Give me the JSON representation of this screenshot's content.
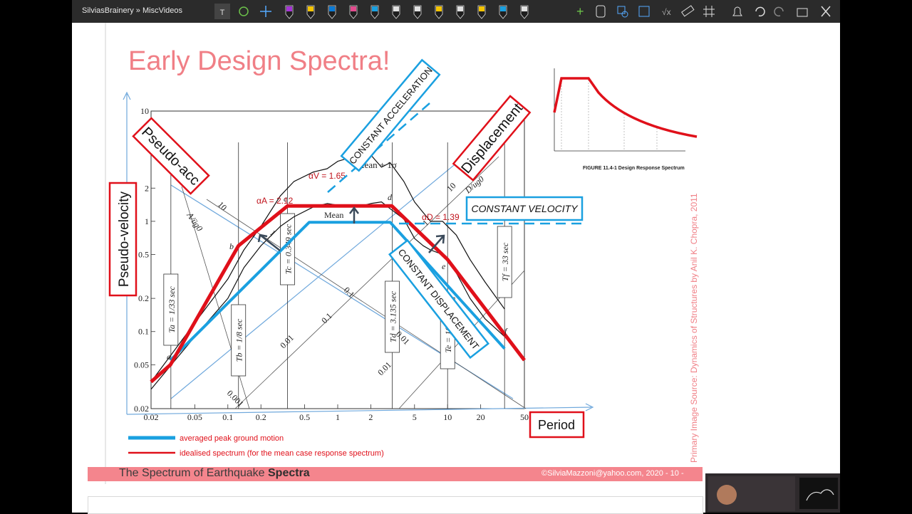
{
  "app": {
    "breadcrumb": "SilviasBrainery » MiscVideos"
  },
  "toolbar": {
    "pen_colors": [
      "#a633d6",
      "#f5c400",
      "#0a7ad6",
      "#e34c8f",
      "#1aa0e0",
      "#e2e2e2",
      "#e2e2e2",
      "#f5c400",
      "#e2e2e2",
      "#f5c400",
      "#1aa0e0",
      "#e2e2e2"
    ]
  },
  "slide": {
    "title": "Early Design Spectra!",
    "footer_left_prefix": "The Spectrum of Earthquake ",
    "footer_left_bold": "Spectra",
    "footer_right": "©SilviaMazzoni@yahoo.com, 2020 - 10 -",
    "source_note": "Primary Image Source: Dynamics of Structures by Anil K. Chopra, 2011",
    "legend": {
      "blue": "averaged peak ground motion",
      "red": "idealised spectrum (for the mean case response spectrum)"
    },
    "boxes": {
      "pseudo_acc": "Pseudo-acc",
      "pseudo_velocity": "Pseudo-velocity",
      "displacement": "Displacement",
      "constant_acceleration": "CONSTANT ACCELERATION",
      "constant_velocity": "CONSTANT VELOCITY",
      "constant_displacement": "CONSTANT DISPLACEMENT",
      "period": "Period"
    },
    "annotations": {
      "alpha_a": "αA = 2.12",
      "alpha_v": "αV = 1.65",
      "alpha_d": "αD = 1.39",
      "mean_plus": "Mean + 1σ",
      "mean": "Mean",
      "a_over_ug": "A/üg0",
      "d_over_ug": "D/ug0"
    },
    "period_labels": [
      "Ta = 1/33 sec",
      "Tb = 1/8 sec",
      "Tc = 0.349 sec",
      "Td = 3.135 sec",
      "Te = 10 sec",
      "Tf = 33 sec"
    ],
    "point_labels": [
      "a",
      "b",
      "c",
      "d",
      "e",
      "f"
    ],
    "diag_labels": {
      "acc": [
        "10",
        "1",
        "0.1",
        "0.01",
        "0.001"
      ],
      "disp": [
        "10",
        "1",
        "0.1",
        "0.01"
      ]
    },
    "inset_caption": "FIGURE 11.4-1 Design Response Spectrum"
  },
  "chart_data": {
    "type": "line",
    "title": "",
    "xlabel": "",
    "ylabel": "",
    "x_scale": "log",
    "y_scale": "log",
    "xlim": [
      0.02,
      50
    ],
    "ylim": [
      0.02,
      10
    ],
    "x_ticks": [
      "0.02",
      "0.05",
      "0.1",
      "0.2",
      "0.5",
      "1",
      "2",
      "5",
      "10",
      "20",
      "50"
    ],
    "y_ticks": [
      "0.02",
      "0.05",
      "0.1",
      "0.2",
      "0.5",
      "1",
      "2",
      "5",
      "10"
    ],
    "series": [
      {
        "name": "Mean + 1σ",
        "x": [
          0.02,
          0.05,
          0.1,
          0.14,
          0.2,
          0.3,
          0.4,
          0.6,
          0.8,
          1.0,
          1.2,
          1.6,
          2.0,
          2.5,
          3.0,
          4.0,
          5.0,
          6.0,
          7.0,
          9.0,
          12,
          16,
          22,
          33
        ],
        "y": [
          0.035,
          0.12,
          0.3,
          0.55,
          0.9,
          1.7,
          2.3,
          2.8,
          3.0,
          3.5,
          3.7,
          3.9,
          4.0,
          3.1,
          3.4,
          2.3,
          1.5,
          1.2,
          1.0,
          1.0,
          0.75,
          0.45,
          0.28,
          0.16
        ]
      },
      {
        "name": "Mean",
        "x": [
          0.02,
          0.05,
          0.1,
          0.14,
          0.2,
          0.3,
          0.4,
          0.6,
          0.8,
          1.0,
          1.5,
          2.0,
          2.5,
          3.0,
          4.0,
          5.0,
          6.0,
          7.0,
          9.0,
          12,
          16,
          22,
          33
        ],
        "y": [
          0.03,
          0.09,
          0.2,
          0.38,
          0.6,
          0.9,
          1.1,
          1.35,
          1.45,
          1.4,
          1.35,
          1.45,
          1.5,
          1.3,
          1.05,
          0.7,
          0.6,
          0.55,
          0.5,
          0.34,
          0.2,
          0.13,
          0.09
        ]
      },
      {
        "name": "averaged peak ground motion",
        "x": [
          0.03,
          0.55,
          3.0,
          33
        ],
        "y": [
          0.055,
          0.98,
          0.98,
          0.07
        ]
      },
      {
        "name": "idealised spectrum (for the mean case response spectrum)",
        "x": [
          0.02,
          0.03,
          0.125,
          0.35,
          3.1,
          10,
          50
        ],
        "y": [
          0.035,
          0.05,
          0.6,
          1.38,
          1.38,
          0.45,
          0.055
        ]
      }
    ]
  }
}
